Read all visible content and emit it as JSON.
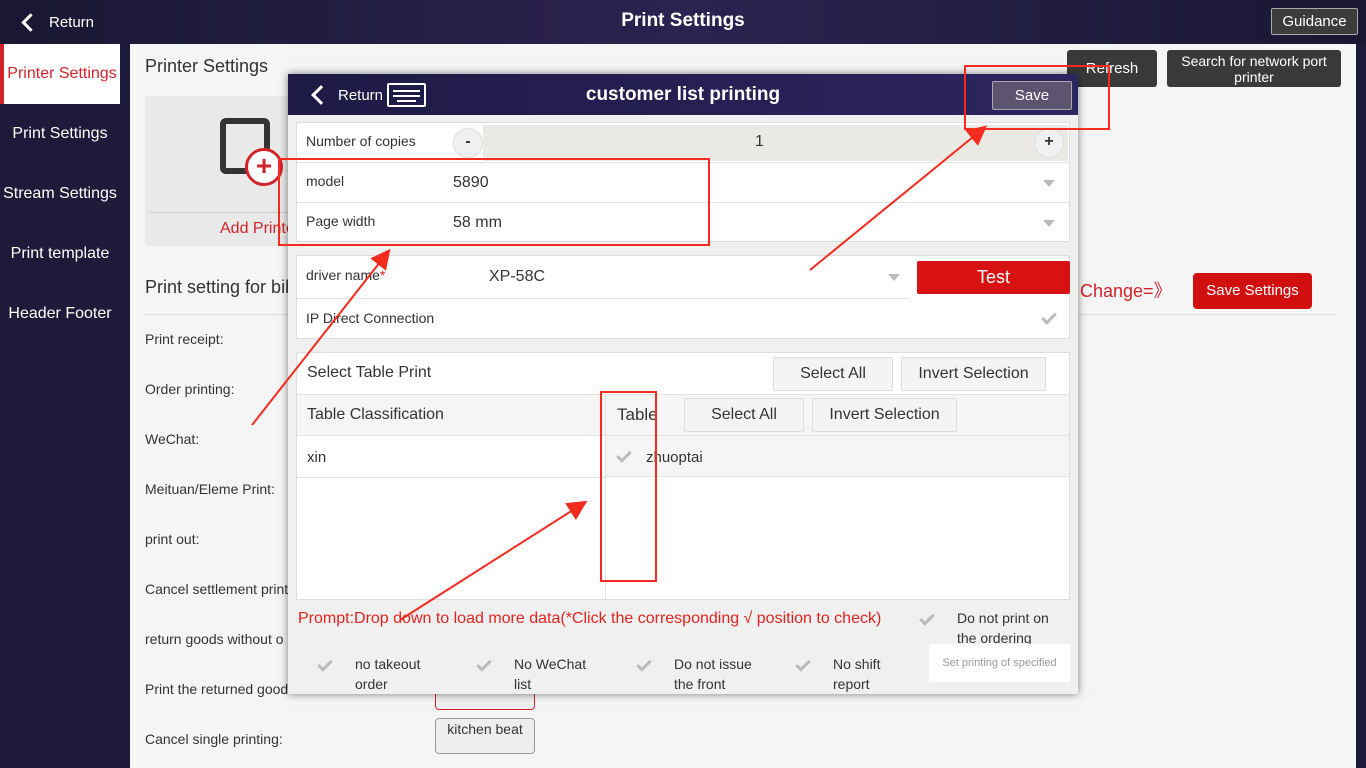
{
  "header": {
    "return_label": "Return",
    "title": "Print Settings",
    "guidance_label": "Guidance"
  },
  "sidebar": {
    "items": [
      {
        "label": "Printer Settings",
        "active": true
      },
      {
        "label": "Print Settings"
      },
      {
        "label": "Stream Settings"
      },
      {
        "label": "Print template"
      },
      {
        "label": "Header Footer"
      }
    ]
  },
  "main": {
    "title": "Printer Settings",
    "refresh_label": "Refresh",
    "search_network_label": "Search for network port printer",
    "add_printer_label": "Add Printe",
    "setting_title": "Print setting for bil",
    "change_label": "Change=》",
    "save_settings_label": "Save Settings",
    "rows": [
      "Print receipt:",
      "Order printing:",
      "WeChat:",
      "Meituan/Eleme Print:",
      "print out:",
      "Cancel settlement print",
      "return goods without o",
      "Print the returned good",
      "Cancel single printing:"
    ],
    "kitchen_beat_label": "kitchen beat"
  },
  "modal": {
    "return_label": "Return",
    "title": "customer list printing",
    "save_label": "Save",
    "copies_label": "Number of copies",
    "copies_value": "1",
    "minus": "-",
    "plus": "+",
    "model_label": "model",
    "model_value": "5890",
    "page_width_label": "Page width",
    "page_width_value": "58 mm",
    "driver_label": "driver name",
    "required_mark": "*",
    "driver_value": "XP-58C",
    "test_label": "Test",
    "ip_label": "IP Direct Connection",
    "select_table_print_label": "Select Table Print",
    "select_all_label": "Select All",
    "invert_selection_label": "Invert Selection",
    "table_classification_header": "Table Classification",
    "table_header": "Table",
    "classifications": [
      "xin"
    ],
    "tables": [
      "zhuoptai"
    ],
    "prompt": "Prompt:Drop down to load more data(*Click the corresponding √ position to check)",
    "options": [
      {
        "label": "Do not print on the ordering"
      },
      {
        "label": "no takeout order"
      },
      {
        "label": "No WeChat list"
      },
      {
        "label": "Do not issue the front"
      },
      {
        "label": "No shift report"
      }
    ],
    "set_printing_specified": "Set printing of specified"
  },
  "colors": {
    "accent_red": "#d2232a",
    "annotation_red": "#f42b1f",
    "header_dark": "#1e1a45"
  }
}
